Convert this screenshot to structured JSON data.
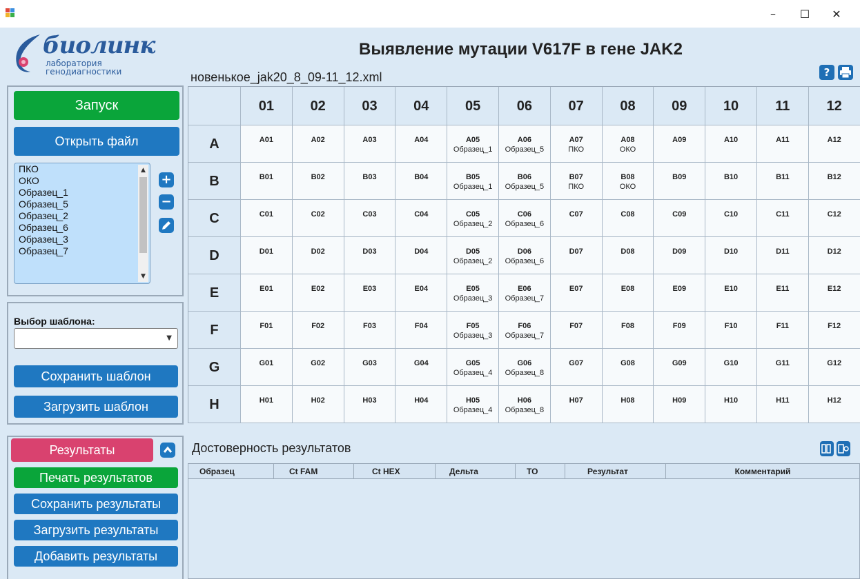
{
  "window": {
    "minimize": "–",
    "maximize": "☐",
    "close": "✕"
  },
  "logo": {
    "name": "биолинк",
    "line1": "лаборатория",
    "line2": "генодиагностики"
  },
  "title": "Выявление мутации V617F в гене JAK2",
  "file_name": "новенькое_jak20_8_09-11_12.xml",
  "header_icons": [
    "help-icon",
    "print-icon"
  ],
  "controls": {
    "start": "Запуск",
    "open_file": "Открыть файл"
  },
  "samples": [
    "ПКО",
    "ОКО",
    "Образец_1",
    "Образец_5",
    "Образец_2",
    "Образец_6",
    "Образец_3",
    "Образец_7"
  ],
  "sample_actions": [
    "add-icon",
    "remove-icon",
    "edit-icon"
  ],
  "template": {
    "label": "Выбор шаблона:",
    "selected": "",
    "save": "Сохранить шаблон",
    "load": "Загрузить шаблон"
  },
  "plate": {
    "columns": [
      "01",
      "02",
      "03",
      "04",
      "05",
      "06",
      "07",
      "08",
      "09",
      "10",
      "11",
      "12"
    ],
    "rows": [
      {
        "label": "A",
        "wells": [
          {
            "id": "A01",
            "sample": ""
          },
          {
            "id": "A02",
            "sample": ""
          },
          {
            "id": "A03",
            "sample": ""
          },
          {
            "id": "A04",
            "sample": ""
          },
          {
            "id": "A05",
            "sample": "Образец_1"
          },
          {
            "id": "A06",
            "sample": "Образец_5"
          },
          {
            "id": "A07",
            "sample": "ПКО"
          },
          {
            "id": "A08",
            "sample": "ОКО"
          },
          {
            "id": "A09",
            "sample": ""
          },
          {
            "id": "A10",
            "sample": ""
          },
          {
            "id": "A11",
            "sample": ""
          },
          {
            "id": "A12",
            "sample": ""
          }
        ]
      },
      {
        "label": "B",
        "wells": [
          {
            "id": "B01",
            "sample": ""
          },
          {
            "id": "B02",
            "sample": ""
          },
          {
            "id": "B03",
            "sample": ""
          },
          {
            "id": "B04",
            "sample": ""
          },
          {
            "id": "B05",
            "sample": "Образец_1"
          },
          {
            "id": "B06",
            "sample": "Образец_5"
          },
          {
            "id": "B07",
            "sample": "ПКО"
          },
          {
            "id": "B08",
            "sample": "ОКО"
          },
          {
            "id": "B09",
            "sample": ""
          },
          {
            "id": "B10",
            "sample": ""
          },
          {
            "id": "B11",
            "sample": ""
          },
          {
            "id": "B12",
            "sample": ""
          }
        ]
      },
      {
        "label": "C",
        "wells": [
          {
            "id": "C01",
            "sample": ""
          },
          {
            "id": "C02",
            "sample": ""
          },
          {
            "id": "C03",
            "sample": ""
          },
          {
            "id": "C04",
            "sample": ""
          },
          {
            "id": "C05",
            "sample": "Образец_2"
          },
          {
            "id": "C06",
            "sample": "Образец_6"
          },
          {
            "id": "C07",
            "sample": ""
          },
          {
            "id": "C08",
            "sample": ""
          },
          {
            "id": "C09",
            "sample": ""
          },
          {
            "id": "C10",
            "sample": ""
          },
          {
            "id": "C11",
            "sample": ""
          },
          {
            "id": "C12",
            "sample": ""
          }
        ]
      },
      {
        "label": "D",
        "wells": [
          {
            "id": "D01",
            "sample": ""
          },
          {
            "id": "D02",
            "sample": ""
          },
          {
            "id": "D03",
            "sample": ""
          },
          {
            "id": "D04",
            "sample": ""
          },
          {
            "id": "D05",
            "sample": "Образец_2"
          },
          {
            "id": "D06",
            "sample": "Образец_6"
          },
          {
            "id": "D07",
            "sample": ""
          },
          {
            "id": "D08",
            "sample": ""
          },
          {
            "id": "D09",
            "sample": ""
          },
          {
            "id": "D10",
            "sample": ""
          },
          {
            "id": "D11",
            "sample": ""
          },
          {
            "id": "D12",
            "sample": ""
          }
        ]
      },
      {
        "label": "E",
        "wells": [
          {
            "id": "E01",
            "sample": ""
          },
          {
            "id": "E02",
            "sample": ""
          },
          {
            "id": "E03",
            "sample": ""
          },
          {
            "id": "E04",
            "sample": ""
          },
          {
            "id": "E05",
            "sample": "Образец_3"
          },
          {
            "id": "E06",
            "sample": "Образец_7"
          },
          {
            "id": "E07",
            "sample": ""
          },
          {
            "id": "E08",
            "sample": ""
          },
          {
            "id": "E09",
            "sample": ""
          },
          {
            "id": "E10",
            "sample": ""
          },
          {
            "id": "E11",
            "sample": ""
          },
          {
            "id": "E12",
            "sample": ""
          }
        ]
      },
      {
        "label": "F",
        "wells": [
          {
            "id": "F01",
            "sample": ""
          },
          {
            "id": "F02",
            "sample": ""
          },
          {
            "id": "F03",
            "sample": ""
          },
          {
            "id": "F04",
            "sample": ""
          },
          {
            "id": "F05",
            "sample": "Образец_3"
          },
          {
            "id": "F06",
            "sample": "Образец_7"
          },
          {
            "id": "F07",
            "sample": ""
          },
          {
            "id": "F08",
            "sample": ""
          },
          {
            "id": "F09",
            "sample": ""
          },
          {
            "id": "F10",
            "sample": ""
          },
          {
            "id": "F11",
            "sample": ""
          },
          {
            "id": "F12",
            "sample": ""
          }
        ]
      },
      {
        "label": "G",
        "wells": [
          {
            "id": "G01",
            "sample": ""
          },
          {
            "id": "G02",
            "sample": ""
          },
          {
            "id": "G03",
            "sample": ""
          },
          {
            "id": "G04",
            "sample": ""
          },
          {
            "id": "G05",
            "sample": "Образец_4"
          },
          {
            "id": "G06",
            "sample": "Образец_8"
          },
          {
            "id": "G07",
            "sample": ""
          },
          {
            "id": "G08",
            "sample": ""
          },
          {
            "id": "G09",
            "sample": ""
          },
          {
            "id": "G10",
            "sample": ""
          },
          {
            "id": "G11",
            "sample": ""
          },
          {
            "id": "G12",
            "sample": ""
          }
        ]
      },
      {
        "label": "H",
        "wells": [
          {
            "id": "H01",
            "sample": ""
          },
          {
            "id": "H02",
            "sample": ""
          },
          {
            "id": "H03",
            "sample": ""
          },
          {
            "id": "H04",
            "sample": ""
          },
          {
            "id": "H05",
            "sample": "Образец_4"
          },
          {
            "id": "H06",
            "sample": "Образец_8"
          },
          {
            "id": "H07",
            "sample": ""
          },
          {
            "id": "H08",
            "sample": ""
          },
          {
            "id": "H09",
            "sample": ""
          },
          {
            "id": "H10",
            "sample": ""
          },
          {
            "id": "H11",
            "sample": ""
          },
          {
            "id": "H12",
            "sample": ""
          }
        ]
      }
    ]
  },
  "results": {
    "tab": "Результаты",
    "print": "Печать результатов",
    "save": "Сохранить результаты",
    "load": "Загрузить результаты",
    "add": "Добавить результаты",
    "reliability_title": "Достоверность результатов",
    "table_icons": [
      "table-columns-icon",
      "table-settings-icon"
    ],
    "columns": [
      "Образец",
      "Ct FAM",
      "Ct HEX",
      "Дельта",
      "TO",
      "Результат",
      "Комментарий"
    ]
  },
  "colors": {
    "background": "#dbe9f5",
    "green": "#0aa53a",
    "blue": "#1f78c1",
    "pink": "#d9426f"
  }
}
